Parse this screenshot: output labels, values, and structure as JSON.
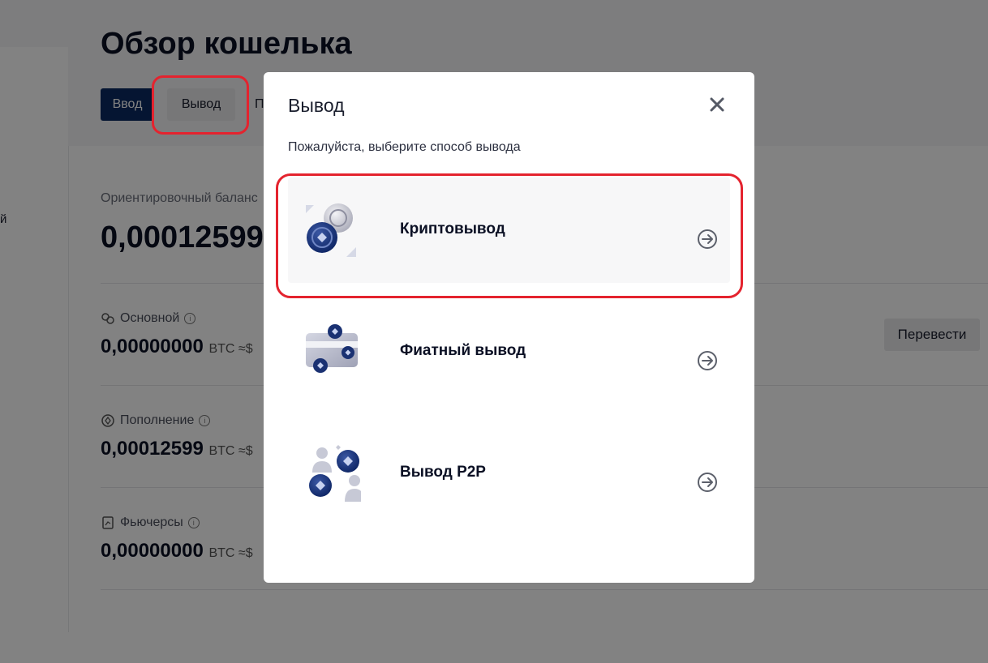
{
  "page": {
    "title": "Обзор кошелька"
  },
  "sidebar": {
    "fragment": "й"
  },
  "actions": {
    "deposit": "Ввод",
    "withdraw": "Вывод",
    "third_fragment": "П"
  },
  "balance": {
    "label": "Ориентировочный баланс",
    "value": "0,00012599"
  },
  "accounts": [
    {
      "label": "Основной",
      "value": "0,00000000",
      "unit": "BTC ≈$",
      "icon": "spot-icon"
    },
    {
      "label": "Пополнение",
      "value": "0,00012599",
      "unit": "BTC ≈$",
      "icon": "funding-icon"
    },
    {
      "label": "Фьючерсы",
      "value": "0,00000000",
      "unit": "BTC ≈$",
      "icon": "futures-icon"
    }
  ],
  "transfer_label": "Перевести",
  "modal": {
    "title": "Вывод",
    "subtitle": "Пожалуйста, выберите способ вывода",
    "options": [
      {
        "label": "Криптовывод",
        "icon": "crypto-coins-icon"
      },
      {
        "label": "Фиатный вывод",
        "icon": "fiat-card-icon"
      },
      {
        "label": "Вывод P2P",
        "icon": "p2p-users-icon"
      }
    ]
  },
  "colors": {
    "primary": "#0b2a63",
    "annotation": "#e4232e",
    "overlay": "rgba(0,0,0,0.49)"
  }
}
